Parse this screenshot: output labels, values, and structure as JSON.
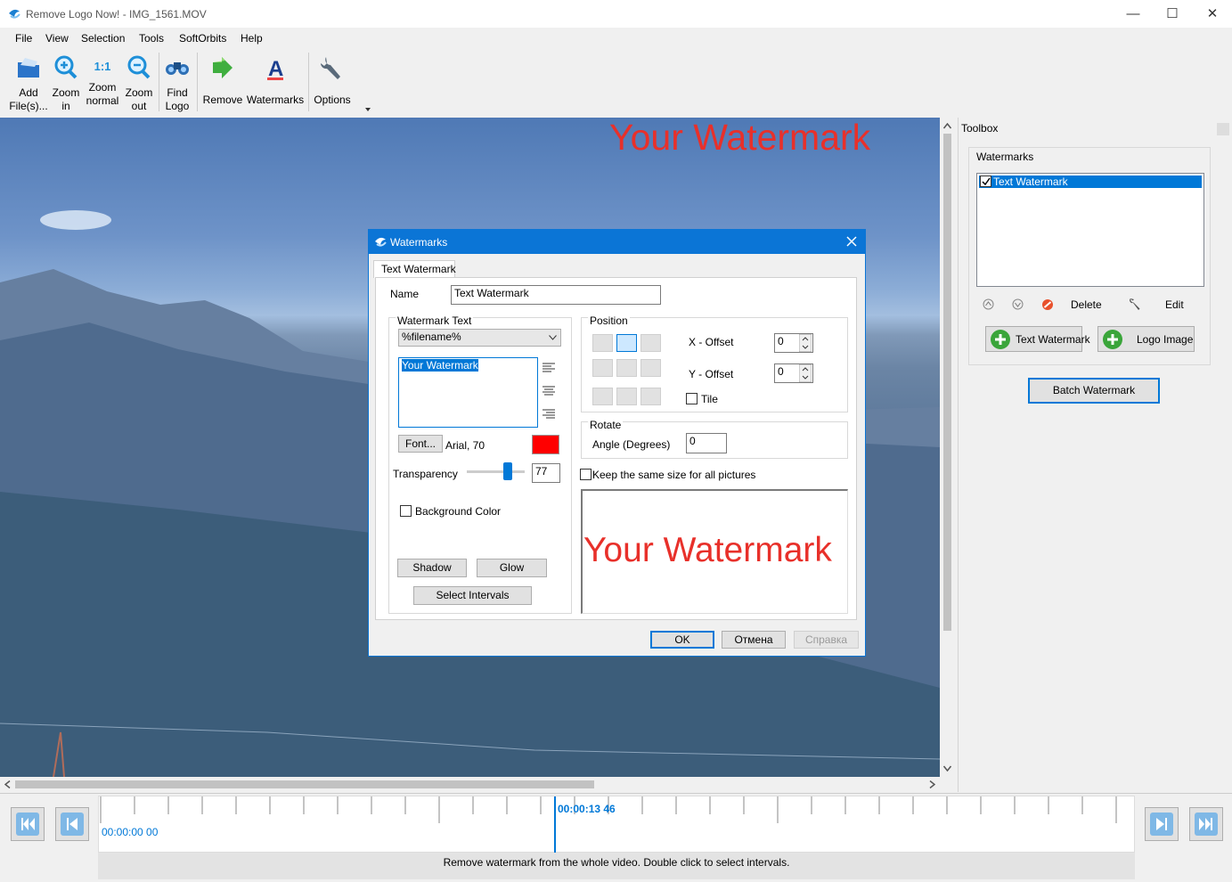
{
  "window": {
    "title": "Remove Logo Now! - IMG_1561.MOV",
    "minimize": "—",
    "maximize": "☐",
    "close": "✕"
  },
  "menu": [
    "File",
    "View",
    "Selection",
    "Tools",
    "SoftOrbits",
    "Help"
  ],
  "toolbar": {
    "add_files": [
      "Add",
      "File(s)..."
    ],
    "zoom_in": [
      "Zoom",
      "in"
    ],
    "zoom_normal": [
      "1:1",
      "Zoom",
      "normal"
    ],
    "zoom_out": [
      "Zoom",
      "out"
    ],
    "find_logo": [
      "Find",
      "Logo"
    ],
    "remove": "Remove",
    "watermarks": "Watermarks",
    "options": "Options"
  },
  "canvas": {
    "watermark_text": "Your Watermark",
    "watermark_color": "#e8302a"
  },
  "toolbox": {
    "title": "Toolbox",
    "group": "Watermarks",
    "items": [
      {
        "label": "Text Watermark",
        "checked": true
      }
    ],
    "delete": "Delete",
    "edit": "Edit",
    "add_text": "Text Watermark",
    "add_logo": "Logo Image",
    "batch": "Batch Watermark"
  },
  "dialog": {
    "title": "Watermarks",
    "tab": "Text Watermark",
    "name_label": "Name",
    "name_value": "Text Watermark",
    "text_group": "Watermark Text",
    "macro_select": "%filename%",
    "text_value": "Your Watermark",
    "font_button": "Font...",
    "font_value": "Arial, 70",
    "font_color": "#ff0000",
    "transparency_label": "Transparency",
    "transparency_value": "77",
    "bg_color_label": "Background Color",
    "shadow": "Shadow",
    "glow": "Glow",
    "select_intervals": "Select Intervals",
    "position_group": "Position",
    "x_offset_label": "X - Offset",
    "x_offset": "0",
    "y_offset_label": "Y - Offset",
    "y_offset": "0",
    "tile_label": "Tile",
    "rotate_group": "Rotate",
    "angle_label": "Angle (Degrees)",
    "angle_value": "0",
    "keep_size_label": "Keep the same size for all pictures",
    "preview_text": "Your Watermark",
    "ok": "OK",
    "cancel": "Отмена",
    "help": "Справка"
  },
  "timeline": {
    "start_time": "00:00:00 00",
    "cursor_time": "00:00:13 46",
    "status": "Remove watermark from the whole video. Double click to select intervals."
  }
}
